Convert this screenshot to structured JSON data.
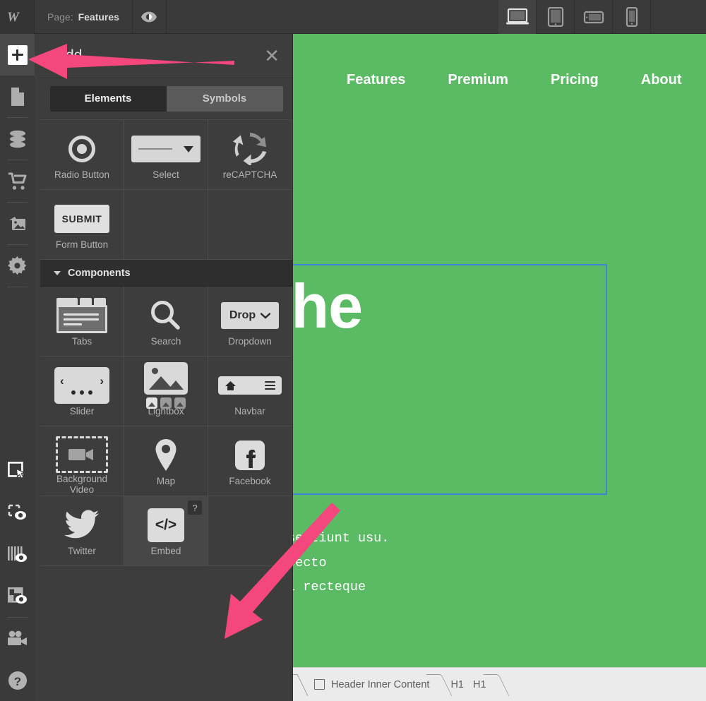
{
  "colors": {
    "canvas_green": "#5BBB65",
    "panel_bg": "#3D3D3D",
    "topbar_bg": "#3A3A3A",
    "annotation_pink": "#F4477E",
    "selection_blue": "#3B84D6",
    "breadcrumb_bg": "#EBEBEB"
  },
  "topbar": {
    "logo_icon": "webflow-logo-icon",
    "page_label": "Page:",
    "page_value": "Features",
    "preview_icon": "eye-preview-icon",
    "devices": [
      {
        "name": "desktop",
        "icon": "desktop-icon",
        "active": true
      },
      {
        "name": "tablet",
        "icon": "tablet-icon",
        "active": false
      },
      {
        "name": "tablet-landscape",
        "icon": "tablet-landscape-icon",
        "active": false
      },
      {
        "name": "mobile",
        "icon": "mobile-icon",
        "active": false
      }
    ]
  },
  "rail": {
    "top_items": [
      {
        "name": "add-elements",
        "icon": "plus-icon",
        "active": true
      },
      {
        "name": "pages",
        "icon": "page-document-icon",
        "active": false
      },
      {
        "name": "cms-collections",
        "icon": "database-icon",
        "active": false
      },
      {
        "name": "ecommerce",
        "icon": "shopping-cart-icon",
        "active": false
      },
      {
        "name": "assets",
        "icon": "images-icon",
        "active": false
      },
      {
        "name": "project-settings",
        "icon": "gear-icon",
        "active": false
      }
    ],
    "bottom_items": [
      {
        "name": "select-tool",
        "icon": "cursor-select-icon",
        "active": true
      },
      {
        "name": "show-element-outlines",
        "icon": "dashed-box-eye-icon",
        "active": false
      },
      {
        "name": "show-guides",
        "icon": "columns-eye-icon",
        "active": false
      },
      {
        "name": "show-layout-preview",
        "icon": "layout-eye-icon",
        "active": false
      },
      {
        "name": "video-tutorials",
        "icon": "video-camera-icon",
        "active": false
      },
      {
        "name": "help",
        "icon": "question-mark-icon",
        "active": false
      }
    ]
  },
  "panel": {
    "title": "Add",
    "close_icon": "close-x-icon",
    "tabs": [
      {
        "label": "Elements",
        "active": true
      },
      {
        "label": "Symbols",
        "active": false
      }
    ],
    "groups": [
      {
        "name": "forms-continued",
        "header": null,
        "cells": [
          {
            "label": "Radio Button",
            "icon": "radio-button-icon",
            "hover": false
          },
          {
            "label": "Select",
            "icon": "select-dropdown-icon",
            "hover": false
          },
          {
            "label": "reCAPTCHA",
            "icon": "recaptcha-icon",
            "hover": false
          },
          {
            "label": "Form Button",
            "icon": "submit-button-icon",
            "hover": false
          },
          {
            "label": "",
            "icon": "",
            "hover": false
          },
          {
            "label": "",
            "icon": "",
            "hover": false
          }
        ]
      },
      {
        "name": "components",
        "header": "Components",
        "cells": [
          {
            "label": "Tabs",
            "icon": "tabs-icon",
            "hover": false
          },
          {
            "label": "Search",
            "icon": "magnifier-icon",
            "hover": false
          },
          {
            "label": "Dropdown",
            "icon": "dropdown-icon",
            "hover": false
          },
          {
            "label": "Slider",
            "icon": "slider-icon",
            "hover": false
          },
          {
            "label": "Lightbox",
            "icon": "lightbox-icon",
            "hover": false
          },
          {
            "label": "Navbar",
            "icon": "navbar-icon",
            "hover": false
          },
          {
            "label": "Background\nVideo",
            "icon": "background-video-icon",
            "hover": false
          },
          {
            "label": "Map",
            "icon": "map-pin-icon",
            "hover": false
          },
          {
            "label": "Facebook",
            "icon": "facebook-icon",
            "hover": false
          },
          {
            "label": "Twitter",
            "icon": "twitter-bird-icon",
            "hover": false
          },
          {
            "label": "Embed",
            "icon": "code-embed-icon",
            "hover": true,
            "badge": "?"
          },
          {
            "label": "",
            "icon": "",
            "hover": false
          }
        ]
      }
    ],
    "submit_button_text": "SUBMIT",
    "dropdown_button_text": "Drop"
  },
  "canvas": {
    "nav_links": [
      "Features",
      "Premium",
      "Pricing",
      "About"
    ],
    "heading": "t only the\neals\ns.",
    "body": " ex tota inimicus dissentiunt usu.\nd. Eu nec option perfecto\ngue patrioque, quo ei recteque"
  },
  "breadcrumb": {
    "items": [
      {
        "label": "Header Inner Content",
        "icon": "box-icon"
      }
    ],
    "tags": [
      "H1",
      "H1"
    ]
  }
}
